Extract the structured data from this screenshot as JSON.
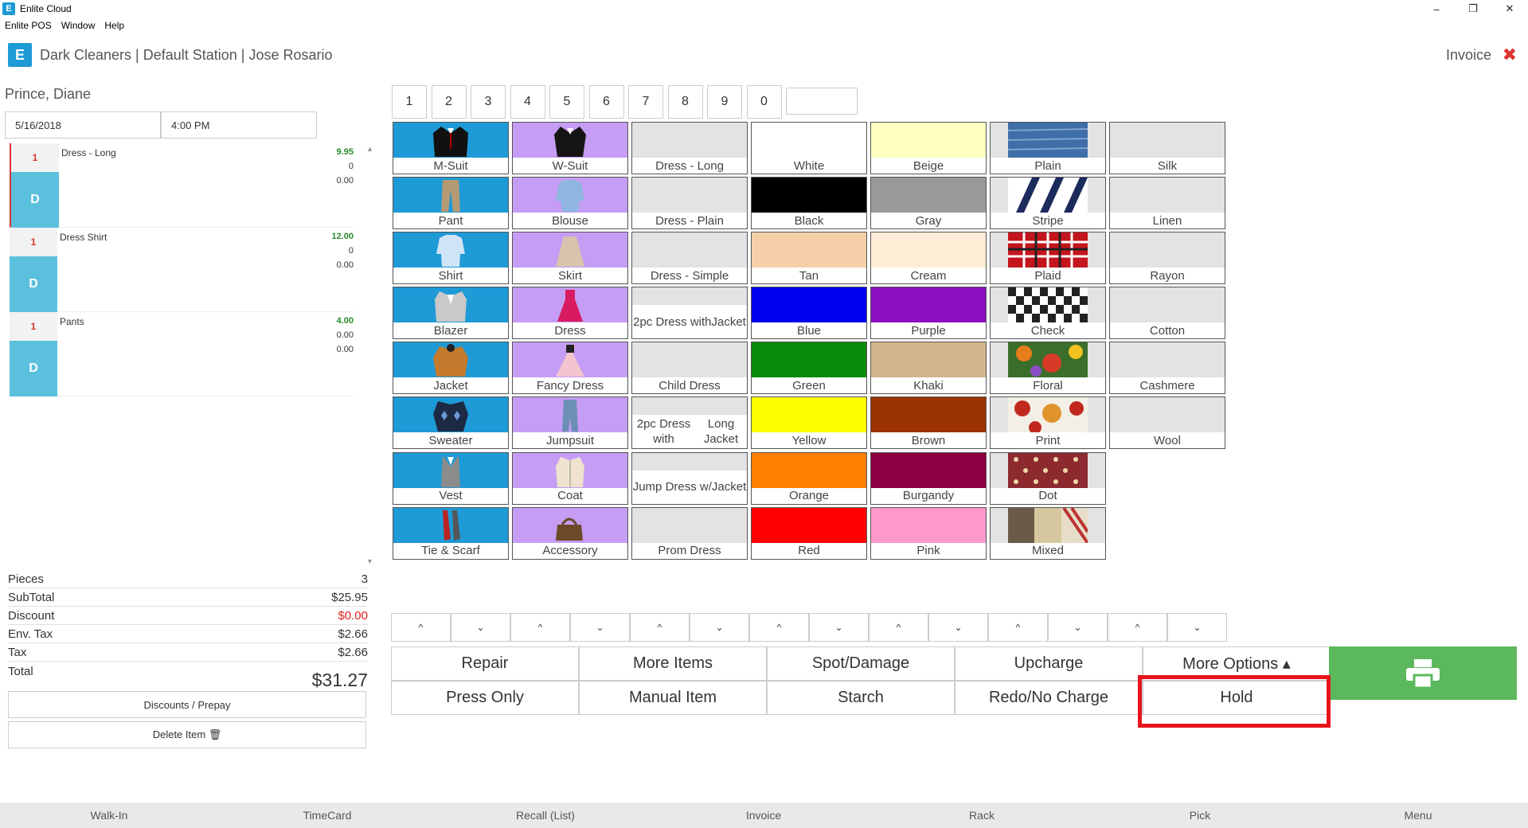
{
  "window": {
    "title": "Enlite Cloud",
    "menu": [
      "Enlite POS",
      "Window",
      "Help"
    ],
    "controls": [
      "–",
      "❐",
      "✕"
    ]
  },
  "header": {
    "logo_letter": "E",
    "title": "Dark Cleaners | Default Station | Jose Rosario",
    "invoice_label": "Invoice",
    "close_icon": "✖"
  },
  "order": {
    "customer": "Prince, Diane",
    "date": "5/16/2018",
    "time": "4:00 PM",
    "items": [
      {
        "qty": "1",
        "badge": "D",
        "name": "Dress - Long",
        "price": "9.95",
        "v2": "0",
        "v3": "0.00"
      },
      {
        "qty": "1",
        "badge": "D",
        "name": "Dress Shirt",
        "price": "12.00",
        "v2": "0",
        "v3": "0.00"
      },
      {
        "qty": "1",
        "badge": "D",
        "name": "Pants",
        "price": "4.00",
        "v2": "0.00",
        "v3": "0.00"
      }
    ]
  },
  "totals": {
    "pieces_label": "Pieces",
    "pieces": "3",
    "subtotal_label": "SubTotal",
    "subtotal": "$25.95",
    "discount_label": "Discount",
    "discount": "$0.00",
    "envtax_label": "Env. Tax",
    "envtax": "$2.66",
    "tax_label": "Tax",
    "tax": "$2.66",
    "total_label": "Total",
    "total": "$31.27"
  },
  "left_buttons": {
    "discounts": "Discounts / Prepay",
    "delete": "Delete Item 🗑"
  },
  "keypad": [
    "1",
    "2",
    "3",
    "4",
    "5",
    "6",
    "7",
    "8",
    "9",
    "0"
  ],
  "garments_men": [
    {
      "label": "M-Suit",
      "icon": "suit-icon"
    },
    {
      "label": "Pant",
      "icon": "pant-icon"
    },
    {
      "label": "Shirt",
      "icon": "shirt-icon"
    },
    {
      "label": "Blazer",
      "icon": "blazer-icon"
    },
    {
      "label": "Jacket",
      "icon": "jacket-icon"
    },
    {
      "label": "Sweater",
      "icon": "sweater-icon"
    },
    {
      "label": "Vest",
      "icon": "vest-icon"
    },
    {
      "label": "Tie & Scarf",
      "icon": "tie-icon"
    }
  ],
  "garments_women": [
    {
      "label": "W-Suit",
      "icon": "suit-icon"
    },
    {
      "label": "Blouse",
      "icon": "blouse-icon"
    },
    {
      "label": "Skirt",
      "icon": "skirt-icon"
    },
    {
      "label": "Dress",
      "icon": "dress-icon"
    },
    {
      "label": "Fancy Dress",
      "icon": "fancy-dress-icon"
    },
    {
      "label": "Jumpsuit",
      "icon": "jumpsuit-icon"
    },
    {
      "label": "Coat",
      "icon": "coat-icon"
    },
    {
      "label": "Accessory",
      "icon": "bag-icon"
    }
  ],
  "dress_types": [
    {
      "line1": "Dress - Long",
      "line2": ""
    },
    {
      "line1": "Dress - Plain",
      "line2": ""
    },
    {
      "line1": "Dress - Simple",
      "line2": ""
    },
    {
      "line1": "2pc Dress with",
      "line2": "Jacket"
    },
    {
      "line1": "Child Dress",
      "line2": ""
    },
    {
      "line1": "2pc Dress with",
      "line2": "Long Jacket"
    },
    {
      "line1": "Jump Dress w/",
      "line2": "Jacket"
    },
    {
      "line1": "Prom Dress",
      "line2": ""
    }
  ],
  "colors1": [
    {
      "label": "White",
      "hex": "#ffffff"
    },
    {
      "label": "Black",
      "hex": "#000000"
    },
    {
      "label": "Tan",
      "hex": "#f5cfa8"
    },
    {
      "label": "Blue",
      "hex": "#0000f0"
    },
    {
      "label": "Green",
      "hex": "#0a8a0a"
    },
    {
      "label": "Yellow",
      "hex": "#ffff00"
    },
    {
      "label": "Orange",
      "hex": "#ff8000"
    },
    {
      "label": "Red",
      "hex": "#ff0000"
    }
  ],
  "colors2": [
    {
      "label": "Beige",
      "hex": "#ffffc0"
    },
    {
      "label": "Gray",
      "hex": "#999999"
    },
    {
      "label": "Cream",
      "hex": "#fdecd6"
    },
    {
      "label": "Purple",
      "hex": "#8a10c0"
    },
    {
      "label": "Khaki",
      "hex": "#d2b48c"
    },
    {
      "label": "Brown",
      "hex": "#9a3300"
    },
    {
      "label": "Burgandy",
      "hex": "#8b0040"
    },
    {
      "label": "Pink",
      "hex": "#ff99cc"
    }
  ],
  "patterns": [
    {
      "label": "Plain",
      "icon": "denim-pattern"
    },
    {
      "label": "Stripe",
      "icon": "stripe-pattern"
    },
    {
      "label": "Plaid",
      "icon": "plaid-pattern"
    },
    {
      "label": "Check",
      "icon": "check-pattern"
    },
    {
      "label": "Floral",
      "icon": "floral-pattern"
    },
    {
      "label": "Print",
      "icon": "print-pattern"
    },
    {
      "label": "Dot",
      "icon": "dot-pattern"
    },
    {
      "label": "Mixed",
      "icon": "mixed-pattern"
    }
  ],
  "fabrics": [
    "Silk",
    "Linen",
    "Rayon",
    "Cotton",
    "Cashmere",
    "Wool"
  ],
  "arrows": {
    "up": "^",
    "down": "⌄"
  },
  "actions": {
    "repair": "Repair",
    "more_items": "More Items",
    "spot": "Spot/Damage",
    "upcharge": "Upcharge",
    "more_options": "More Options ▴",
    "press_only": "Press Only",
    "manual_item": "Manual Item",
    "starch": "Starch",
    "redo": "Redo/No Charge",
    "hold": "Hold"
  },
  "bottom_nav": [
    "Walk-In",
    "TimeCard",
    "Recall (List)",
    "Invoice",
    "Rack",
    "Pick",
    "Menu"
  ]
}
